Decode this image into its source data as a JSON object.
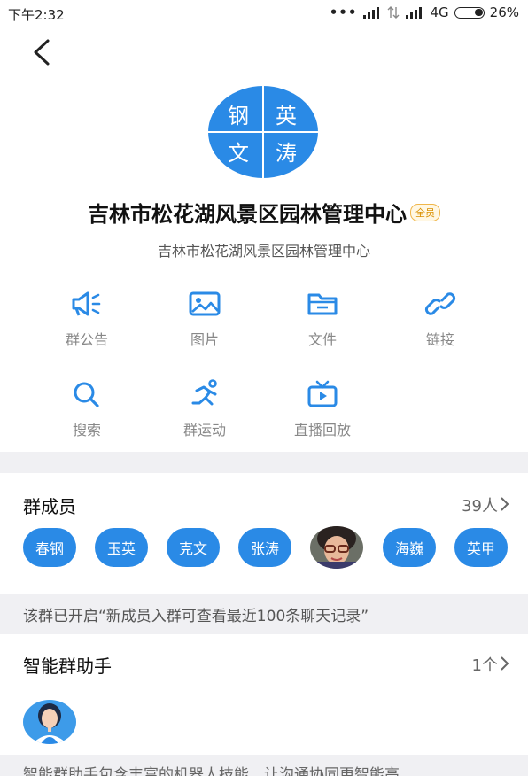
{
  "status_bar": {
    "time": "下午2:32",
    "network": "4G",
    "battery": "26%"
  },
  "group": {
    "avatar_chars": [
      "钢",
      "英",
      "文",
      "涛"
    ],
    "name": "吉林市松花湖风景区园林管理中心",
    "badge": "全员",
    "subtitle": "吉林市松花湖风景区园林管理中心"
  },
  "tools": [
    {
      "label": "群公告",
      "icon": "megaphone-icon"
    },
    {
      "label": "图片",
      "icon": "image-icon"
    },
    {
      "label": "文件",
      "icon": "folder-icon"
    },
    {
      "label": "链接",
      "icon": "link-icon"
    },
    {
      "label": "搜索",
      "icon": "search-icon"
    },
    {
      "label": "群运动",
      "icon": "running-icon"
    },
    {
      "label": "直播回放",
      "icon": "tv-icon"
    }
  ],
  "members": {
    "title": "群成员",
    "count": "39人",
    "list": [
      "春钢",
      "玉英",
      "克文",
      "张涛",
      "",
      "海巍",
      "英甲"
    ]
  },
  "notice": "该群已开启“新成员入群可查看最近100条聊天记录”",
  "assistant": {
    "title": "智能群助手",
    "count": "1个",
    "footer": "智能群助手包含丰富的机器人技能，让沟通协同更智能高"
  },
  "colors": {
    "accent": "#2a8ae6",
    "separator": "#f0f0f3"
  }
}
